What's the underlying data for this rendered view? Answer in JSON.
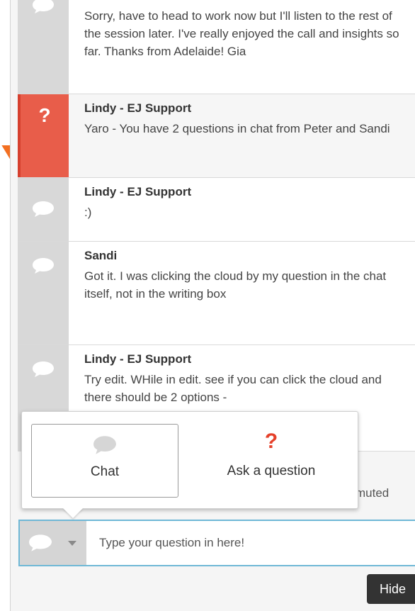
{
  "messages": [
    {
      "author": "",
      "text": "Sorry, have to head to work now but I'll listen to the rest of the session later. I've really enjoyed the call and insights so far. Thanks from Adelaide! Gia",
      "type": "chat"
    },
    {
      "author": "Lindy - EJ Support",
      "text": "Yaro - You have 2 questions in chat from Peter and Sandi",
      "type": "question"
    },
    {
      "author": "Lindy - EJ Support",
      "text": ":)",
      "type": "chat"
    },
    {
      "author": "Sandi",
      "text": "Got it. I was clicking the cloud by my question in the chat itself, not in the writing box",
      "type": "chat"
    },
    {
      "author": "Lindy - EJ Support",
      "text": "Try edit. WHile in edit. see if you can click the cloud and there should be 2 options -",
      "type": "chat"
    }
  ],
  "question_glyph": "?",
  "popup": {
    "chat_label": "Chat",
    "ask_label": "Ask a question",
    "ask_glyph": "?"
  },
  "status": {
    "muted_text": "muted"
  },
  "input": {
    "placeholder": "Type your question in here!",
    "value": ""
  },
  "hide_button": "Hide",
  "colors": {
    "accent": "#6fb8d6",
    "question": "#e85d4a",
    "arrow": "#f36f21"
  }
}
